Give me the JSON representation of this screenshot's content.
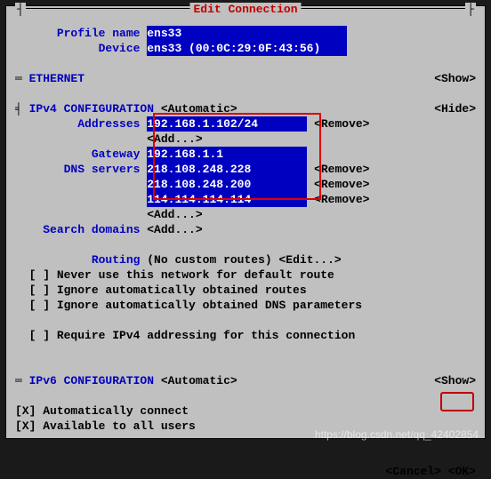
{
  "title": "Edit Connection",
  "profile": {
    "label": "Profile name",
    "value": "ens33"
  },
  "device": {
    "label": "Device",
    "value": "ens33 (00:0C:29:0F:43:56)"
  },
  "ethernet": {
    "label": "ETHERNET",
    "action": "<Show>"
  },
  "ipv4": {
    "label": "IPv4 CONFIGURATION",
    "mode": "<Automatic>",
    "action": "<Hide>",
    "addresses": {
      "label": "Addresses",
      "items": [
        "192.168.1.102/24"
      ],
      "add": "<Add...>",
      "remove": "<Remove>"
    },
    "gateway": {
      "label": "Gateway",
      "value": "192.168.1.1"
    },
    "dns": {
      "label": "DNS servers",
      "items": [
        "218.108.248.228",
        "218.108.248.200",
        "114.114.114.114"
      ],
      "add": "<Add...>",
      "remove": "<Remove>"
    },
    "search": {
      "label": "Search domains",
      "add": "<Add...>"
    },
    "routing": {
      "label": "Routing",
      "value": "(No custom routes)",
      "edit": "<Edit...>"
    },
    "checks": [
      {
        "checked": false,
        "text": "Never use this network for default route"
      },
      {
        "checked": false,
        "text": "Ignore automatically obtained routes"
      },
      {
        "checked": false,
        "text": "Ignore automatically obtained DNS parameters"
      },
      {
        "checked": false,
        "text": "Require IPv4 addressing for this connection"
      }
    ]
  },
  "ipv6": {
    "label": "IPv6 CONFIGURATION",
    "mode": "<Automatic>",
    "action": "<Show>"
  },
  "auto_connect": {
    "checked": true,
    "text": "Automatically connect"
  },
  "all_users": {
    "checked": true,
    "text": "Available to all users"
  },
  "buttons": {
    "cancel": "<Cancel>",
    "ok": "<OK>"
  },
  "watermark": "https://blog.csdn.net/qq_42402854"
}
